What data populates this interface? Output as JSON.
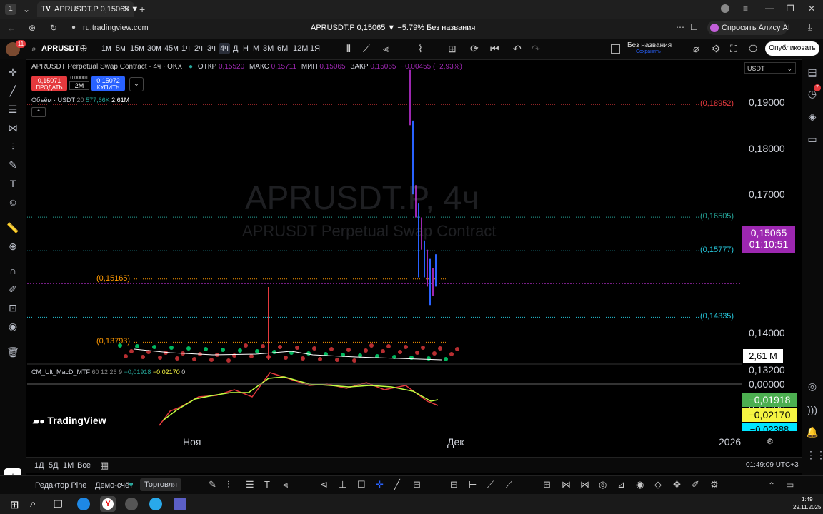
{
  "browser": {
    "tab_title": "APRUSDT.P 0,15065 ▼",
    "url": "ru.tradingview.com",
    "page_title": "APRUSDT.P 0,15065 ▼ −5.79% Без названия",
    "alice_label": "Спросить Алису AI",
    "tab_count": "1"
  },
  "toolbar": {
    "symbol": "APRUSDT",
    "timeframes": [
      "1м",
      "5м",
      "15м",
      "30м",
      "45м",
      "1ч",
      "2ч",
      "3ч",
      "4ч",
      "Д",
      "Н",
      "М",
      "3М",
      "6М",
      "12М",
      "1Я"
    ],
    "active_timeframe": "4ч",
    "layout_name": "Без названия",
    "layout_status": "Сохранить",
    "publish_label": "Опубликовать",
    "avatar_badge": "11"
  },
  "legend": {
    "title": "APRUSDT Perpetual Swap Contract · 4ч · OKX",
    "open_label": "ОТКР",
    "open_value": "0,15520",
    "high_label": "МАКС",
    "high_value": "0,15711",
    "low_label": "МИН",
    "low_value": "0,15065",
    "close_label": "ЗАКР",
    "close_value": "0,15065",
    "change": "−0,00455 (−2,93%)",
    "sell_price": "0,15071",
    "sell_label": "ПРОДАТЬ",
    "spread_top": "0,00001",
    "spread_bottom": "2M",
    "buy_price": "0,15072",
    "buy_label": "КУПИТЬ",
    "volume_label": "Объём · USDT",
    "volume_period": "20",
    "volume_value1": "577,66K",
    "volume_value2": "2,61M"
  },
  "watermark": {
    "line1": "APRUSDT.P, 4ч",
    "line2": "APRUSDT Perpetual Swap Contract"
  },
  "axis": {
    "currency": "USDT",
    "prices": [
      "0,19000",
      "0,18000",
      "0,17000",
      "0,16000",
      "0,14000",
      "0,13200",
      "0,12400"
    ],
    "current_price": "0,15065",
    "countdown": "01:10:51",
    "volume_badge": "2,61 M",
    "macd_zero": "0,00000",
    "macd_v1": "−0,01918",
    "macd_v2": "−0,02170",
    "macd_v3": "−0,02388"
  },
  "levels": [
    {
      "label": "(0,18952)",
      "price": 0.18952,
      "color": "#e5393d"
    },
    {
      "label": "(0,16505)",
      "price": 0.16505,
      "color": "#26a69a"
    },
    {
      "label": "(0,15777)",
      "price": 0.15777,
      "color": "#26c6da"
    },
    {
      "label": "(0,14335)",
      "price": 0.14335,
      "color": "#26c6da"
    },
    {
      "label": "(0,15165)",
      "price": 0.15165,
      "color": "#ff9800"
    },
    {
      "label": "(0,13793)",
      "price": 0.13793,
      "color": "#ff9800"
    }
  ],
  "macd": {
    "title": "CM_Ult_MacD_MTF",
    "params": "60 12 26 9",
    "v1": "−0,01918",
    "v2": "−0,02170",
    "v3": "0"
  },
  "logo": "TradingView",
  "time_axis": {
    "labels": [
      "Ноя",
      "Дек",
      "2026"
    ]
  },
  "range_buttons": [
    "1Д",
    "5Д",
    "1М",
    "Все"
  ],
  "clock": "01:49:09 UTC+3",
  "bottom_tabs": [
    "Редактор Pine",
    "Демо-счёт",
    "Торговля"
  ],
  "taskbar": {
    "time": "1:49",
    "date": "29.11.2025"
  },
  "colors": {
    "accent": "#2962ff",
    "down": "#e5393d",
    "up": "#26a69a",
    "price_badge": "#9c27b0"
  }
}
